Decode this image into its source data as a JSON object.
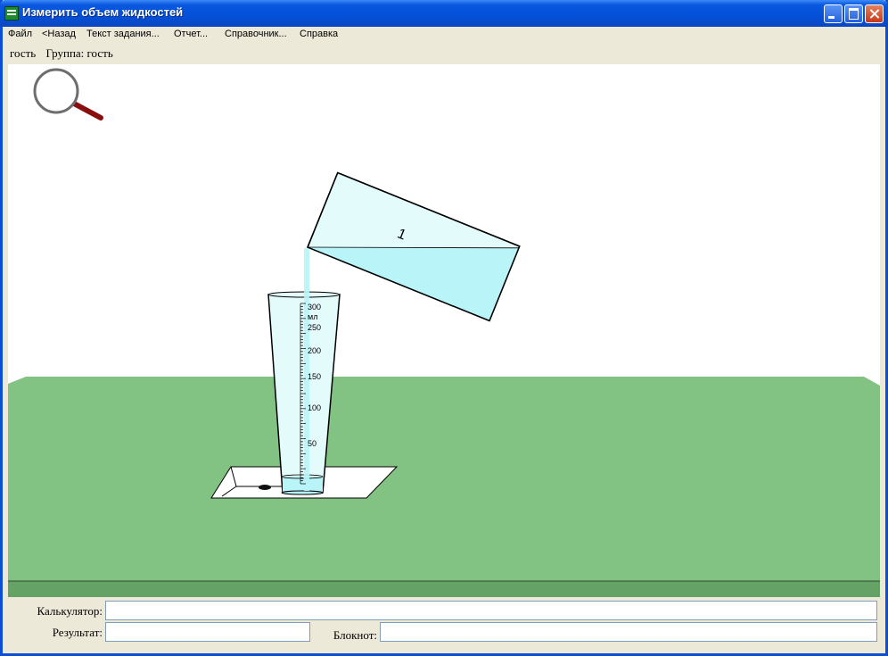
{
  "window": {
    "title": "Измерить объем жидкостей"
  },
  "menu": {
    "items": [
      "Файл",
      "<Назад",
      "Текст задания...",
      "Отчет...",
      "Справочник...",
      "Справка"
    ]
  },
  "user": {
    "name": "гость",
    "group": "Группа: гость"
  },
  "scene": {
    "cylinder_scale": {
      "unit": "мл",
      "labels": [
        "300",
        "250",
        "200",
        "150",
        "100",
        "50"
      ],
      "max_ml": 300,
      "fill_ml": 0
    },
    "beaker": {
      "label": "1",
      "liquid_level": 0.32
    },
    "colors": {
      "table": "#82c283",
      "table_edge": "#64a266",
      "liquid": "#b8f4f8",
      "glass": "#e4fbfc"
    }
  },
  "bottom": {
    "calculator_label": "Калькулятор:",
    "calculator_value": "",
    "result_label": "Результат:",
    "result_value": "",
    "notepad_label": "Блокнот:",
    "notepad_value": ""
  }
}
